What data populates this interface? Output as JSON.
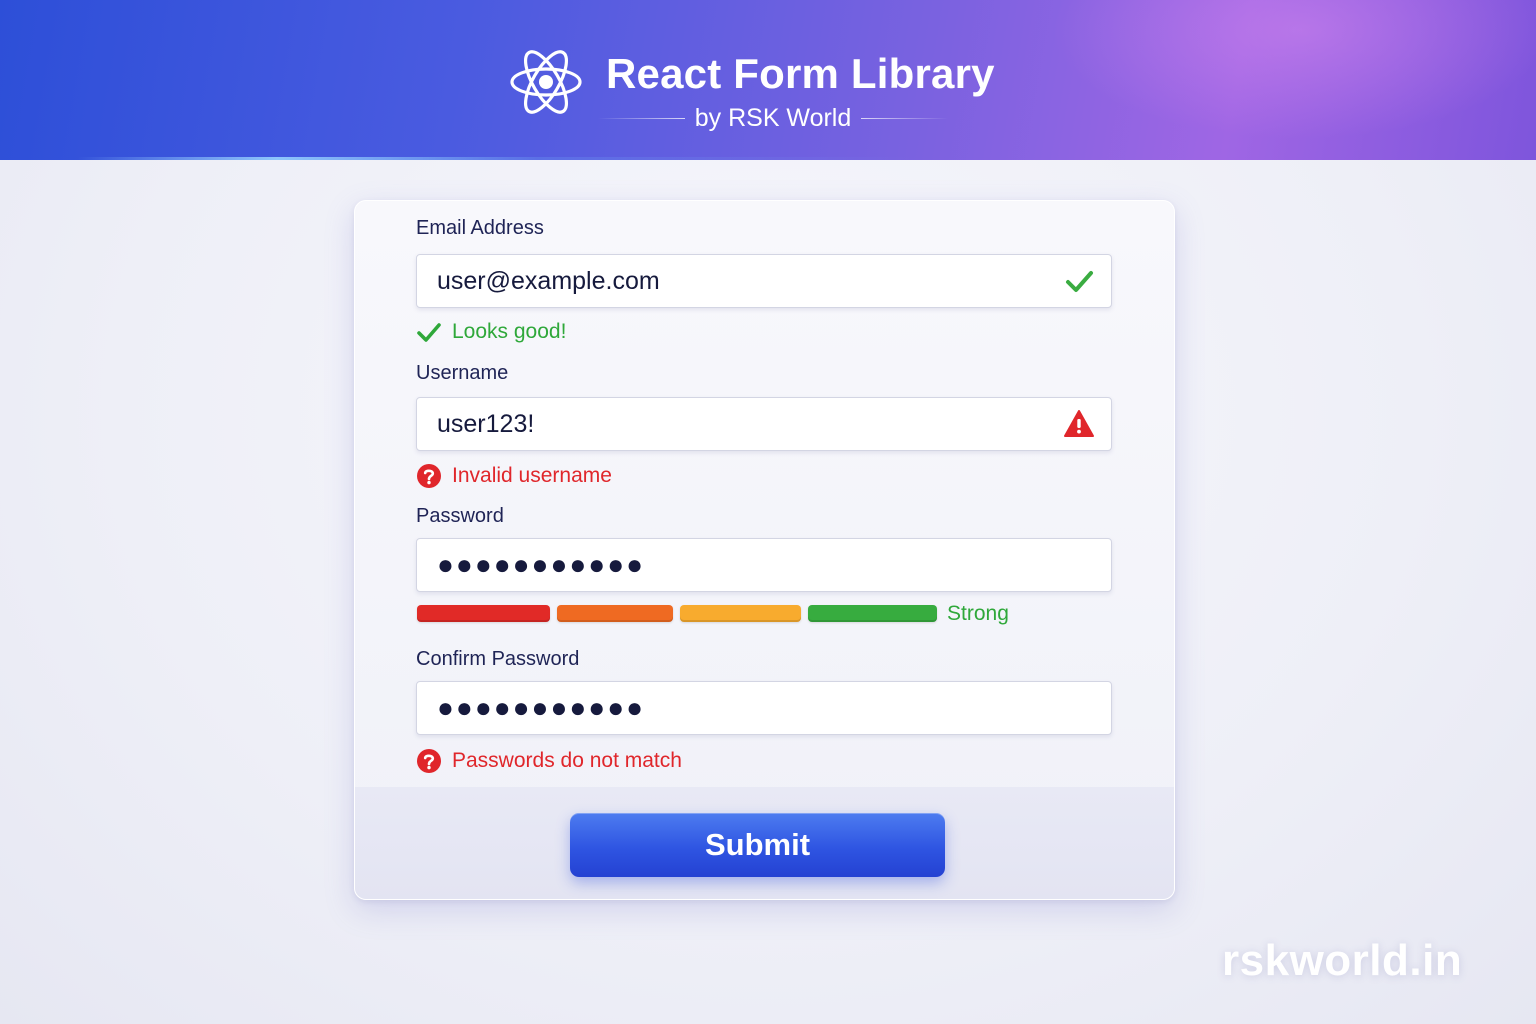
{
  "header": {
    "title": "React Form Library",
    "subtitle": "by RSK World",
    "logo_icon": "react-atom-icon"
  },
  "form": {
    "email": {
      "label": "Email Address",
      "value": "user@example.com",
      "status": "valid",
      "status_icon": "check-icon",
      "message": "Looks good!"
    },
    "username": {
      "label": "Username",
      "value": "user123!",
      "status": "invalid",
      "status_icon": "warning-triangle-icon",
      "message": "Invalid username"
    },
    "password": {
      "label": "Password",
      "masked_value": "●●●●●●●●●●●",
      "strength": {
        "label": "Strong",
        "level": 4,
        "max_level": 4,
        "segment_colors": [
          "#e12a27",
          "#ef6a22",
          "#f8ab2e",
          "#37ac3f"
        ]
      }
    },
    "confirm_password": {
      "label": "Confirm Password",
      "masked_value": "●●●●●●●●●●●",
      "status": "invalid",
      "message": "Passwords do not match"
    },
    "submit_label": "Submit"
  },
  "watermark": "rskworld.in",
  "colors": {
    "accent": "#2f55e2",
    "success": "#2fa83a",
    "error": "#e0262b",
    "label": "#1f2456"
  }
}
